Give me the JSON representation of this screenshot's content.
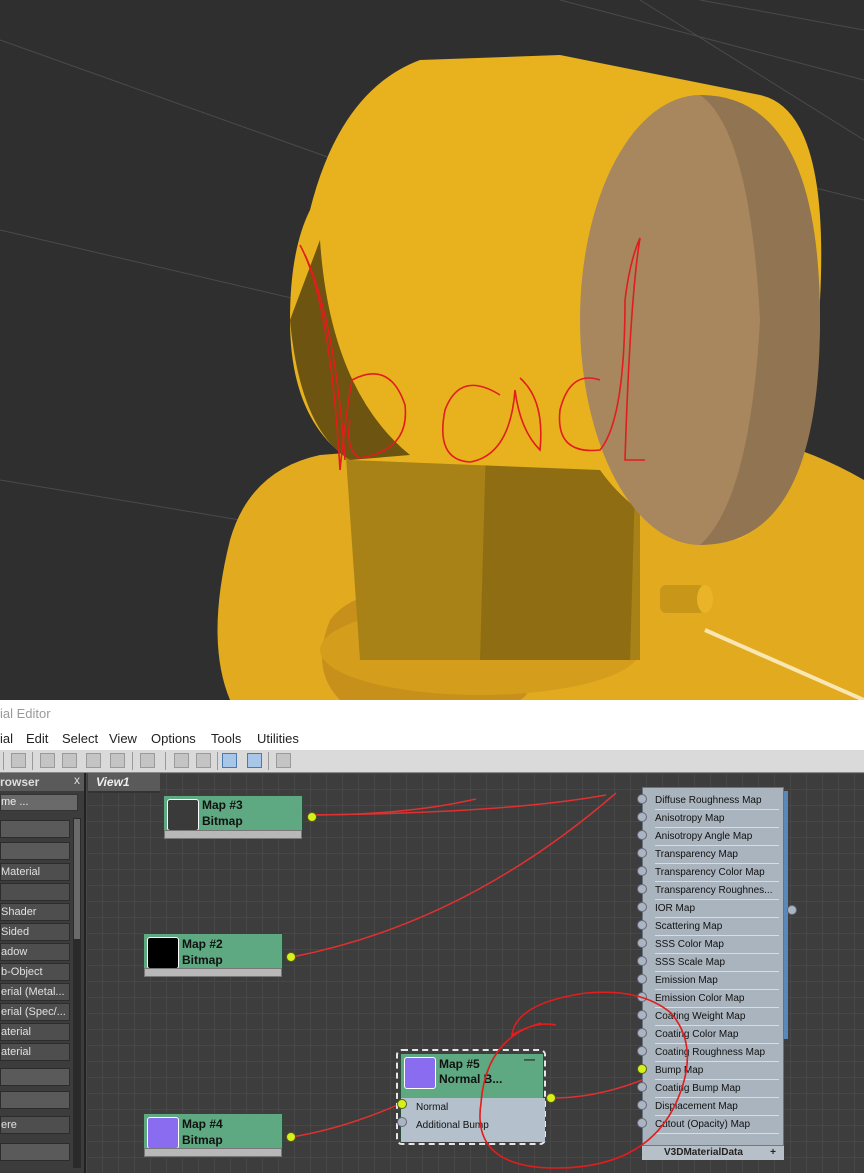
{
  "viewport": {
    "colors": {
      "object": "#e0a91d",
      "shadow": "#8a6a14",
      "background": "#2f2f2f",
      "annotation": "#e11d1d"
    }
  },
  "editor": {
    "title": "ial Editor",
    "menu": [
      "ial",
      "Edit",
      "Select",
      "View",
      "Options",
      "Tools",
      "Utilities"
    ],
    "browser": {
      "title": "rowser",
      "close": "x",
      "search": "me ...",
      "items": [
        "",
        "",
        "Material",
        "",
        "Shader",
        "Sided",
        "adow",
        "b-Object",
        "erial (Metal...",
        "erial (Spec/...",
        "aterial",
        "aterial",
        "",
        "",
        "ere",
        ""
      ]
    },
    "view_tab": "View1",
    "nodes": {
      "map3": {
        "name": "Map #3",
        "type": "Bitmap",
        "swatch": "#3a3a3a"
      },
      "map2": {
        "name": "Map #2",
        "type": "Bitmap",
        "swatch": "#000000"
      },
      "map4": {
        "name": "Map #4",
        "type": "Bitmap",
        "swatch": "#8a6cf0"
      },
      "map5": {
        "name": "Map #5",
        "type": "Normal B...",
        "swatch": "#8a6cf0",
        "collapse": "—",
        "inputs": [
          "Normal",
          "Additional Bump"
        ]
      }
    },
    "material": {
      "name": "V3DMaterialData",
      "expand": "+",
      "slots": [
        "Diffuse Roughness Map",
        "Anisotropy Map",
        "Anisotropy Angle Map",
        "Transparency Map",
        "Transparency Color Map",
        "Transparency Roughnes...",
        "IOR Map",
        "Scattering Map",
        "SSS Color Map",
        "SSS Scale Map",
        "Emission Map",
        "Emission Color Map",
        "Coating Weight Map",
        "Coating Color Map",
        "Coating Roughness Map",
        "Bump Map",
        "Coating Bump Map",
        "Displacement Map",
        "Cutout (Opacity) Map"
      ],
      "connected_slot": "Bump Map"
    }
  }
}
